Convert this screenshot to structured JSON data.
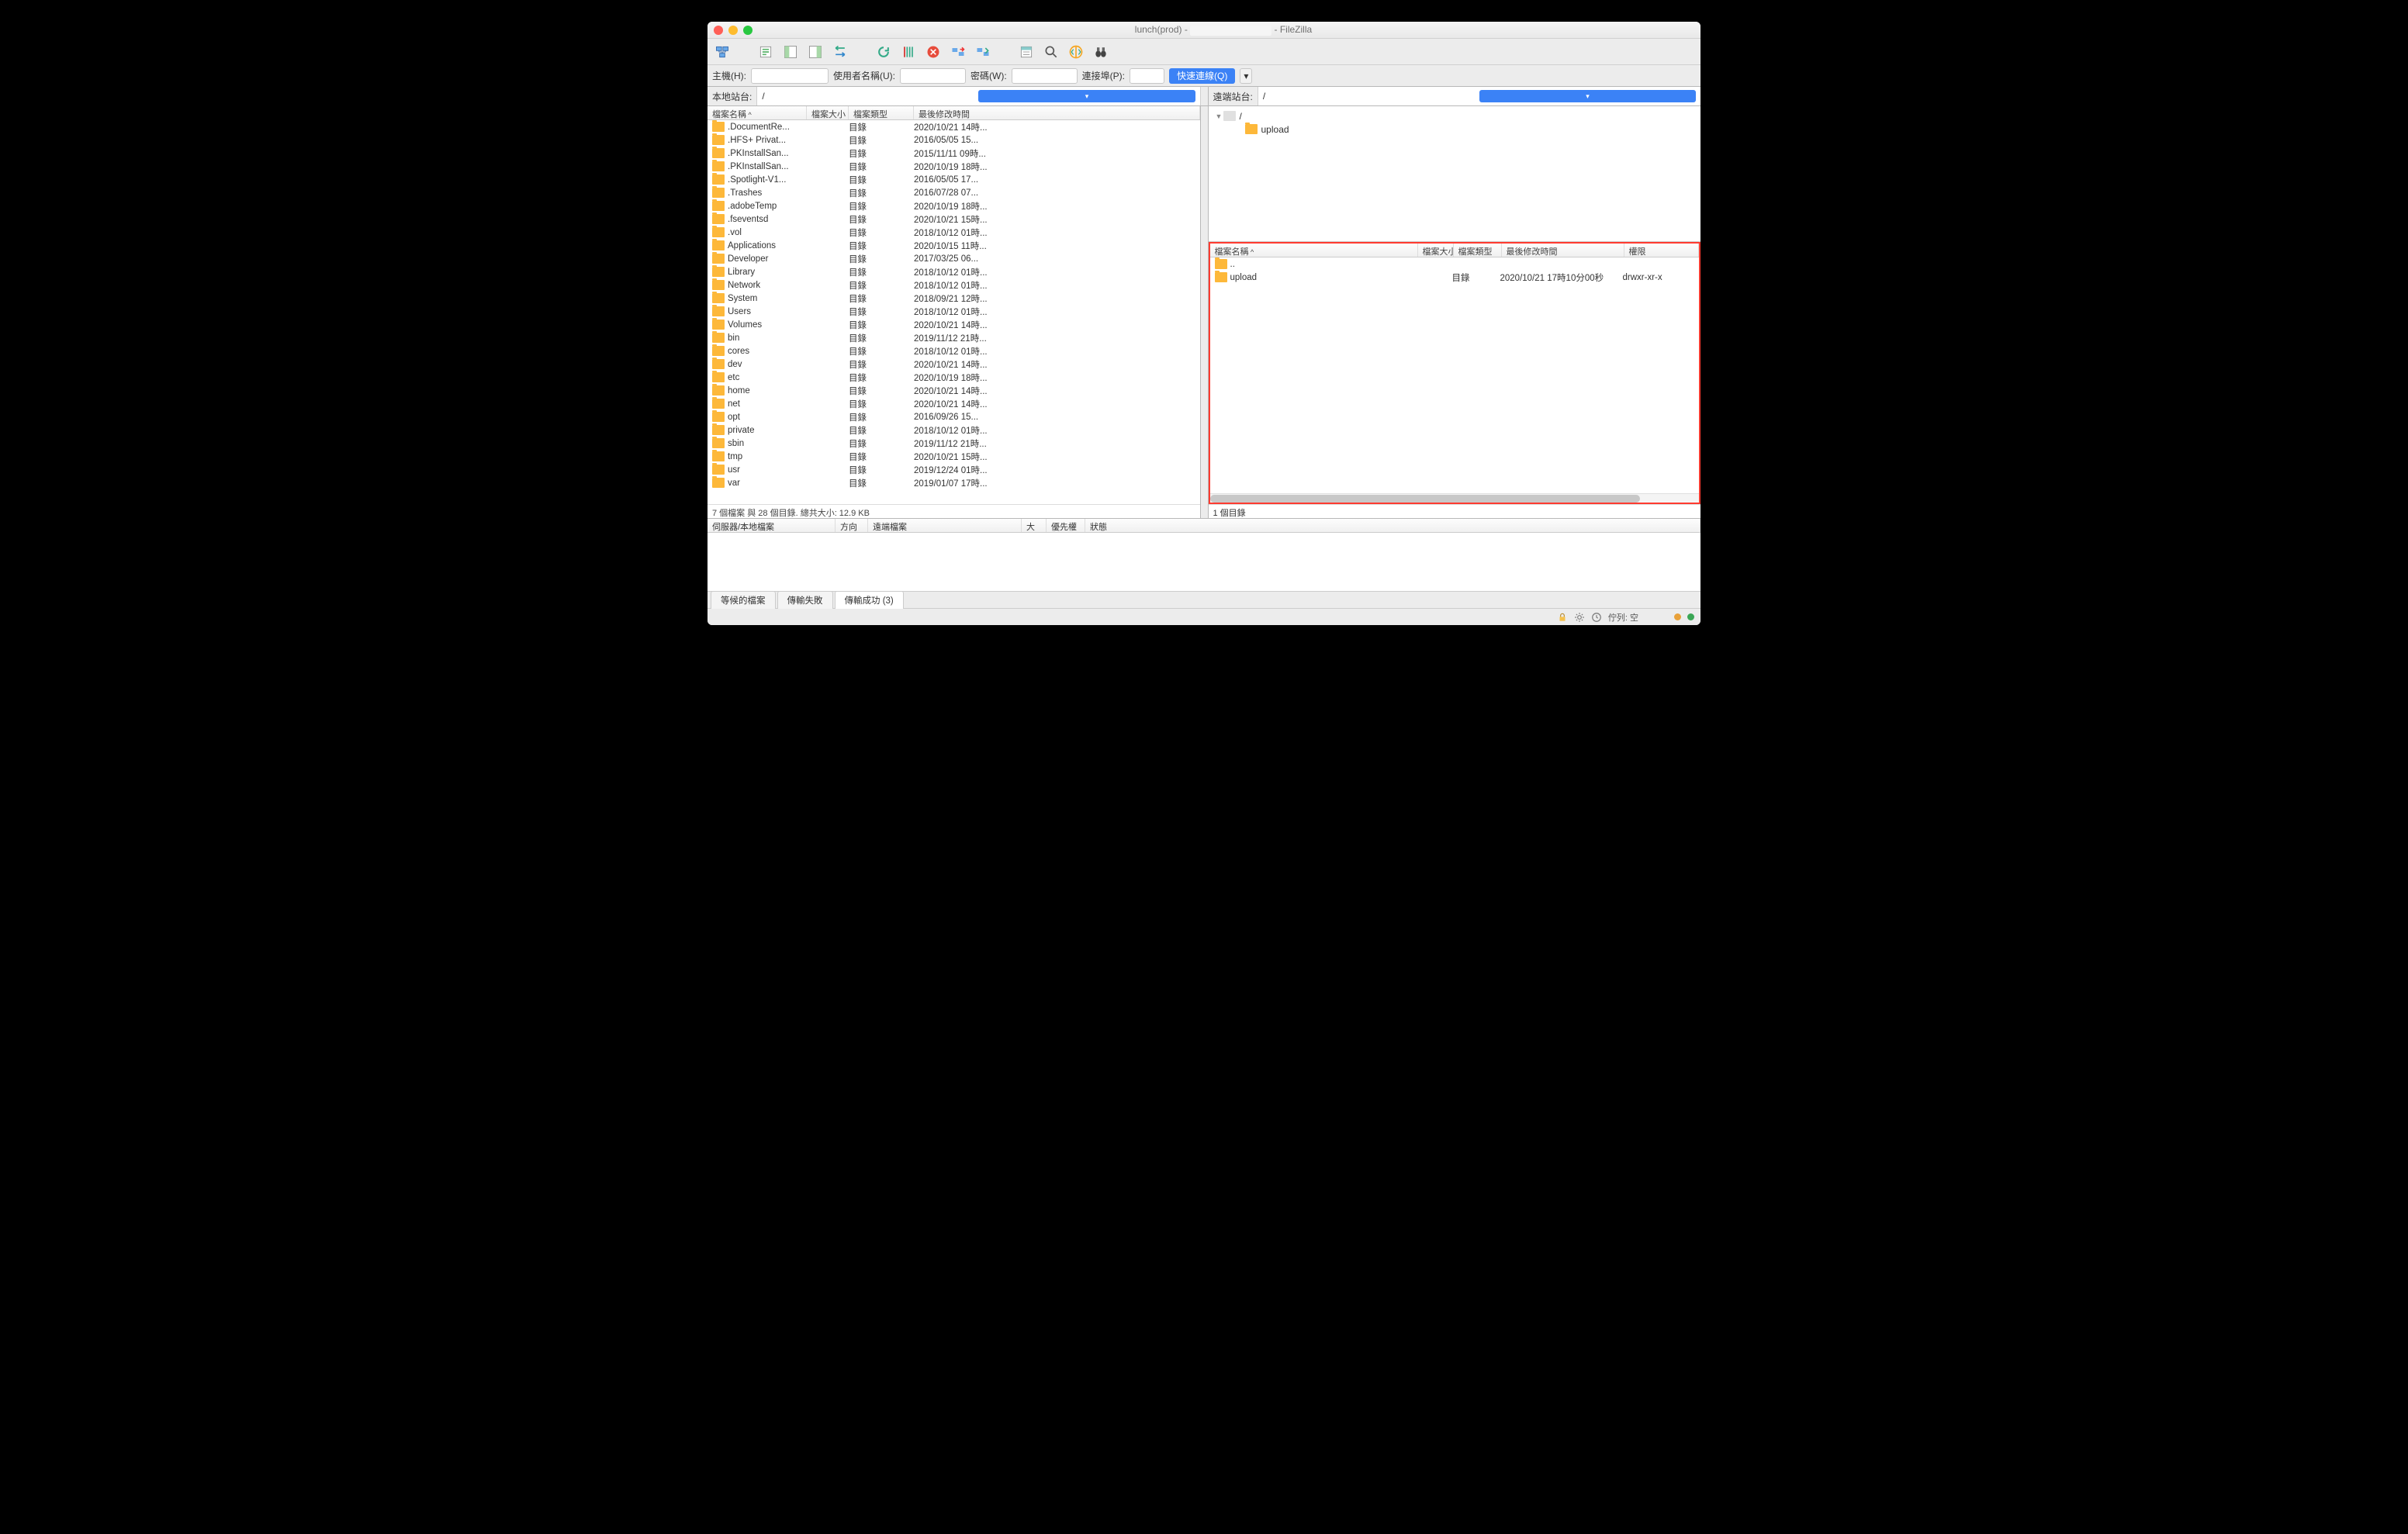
{
  "title": {
    "prefix": "lunch(prod) - ",
    "suffix": " - FileZilla"
  },
  "qc": {
    "host_label": "主機(H):",
    "user_label": "使用者名稱(U):",
    "pass_label": "密碼(W):",
    "port_label": "連接埠(P):",
    "btn": "快速連線(Q)"
  },
  "local": {
    "site_label": "本地站台:",
    "path": "/",
    "cols": {
      "name": "檔案名稱",
      "size": "檔案大小",
      "type": "檔案類型",
      "time": "最後修改時間"
    },
    "type_dir": "目錄",
    "status": "7 個檔案 與 28 個目錄. 總共大小: 12.9 KB",
    "rows": [
      {
        "name": ".DocumentRe...",
        "time": "2020/10/21 14時..."
      },
      {
        "name": ".HFS+ Privat...",
        "time": "2016/05/05 15..."
      },
      {
        "name": ".PKInstallSan...",
        "time": "2015/11/11 09時..."
      },
      {
        "name": ".PKInstallSan...",
        "time": "2020/10/19 18時..."
      },
      {
        "name": ".Spotlight-V1...",
        "time": "2016/05/05 17..."
      },
      {
        "name": ".Trashes",
        "time": "2016/07/28 07..."
      },
      {
        "name": ".adobeTemp",
        "time": "2020/10/19 18時..."
      },
      {
        "name": ".fseventsd",
        "time": "2020/10/21 15時..."
      },
      {
        "name": ".vol",
        "time": "2018/10/12 01時..."
      },
      {
        "name": "Applications",
        "time": "2020/10/15 11時..."
      },
      {
        "name": "Developer",
        "time": "2017/03/25 06..."
      },
      {
        "name": "Library",
        "time": "2018/10/12 01時..."
      },
      {
        "name": "Network",
        "time": "2018/10/12 01時..."
      },
      {
        "name": "System",
        "time": "2018/09/21 12時..."
      },
      {
        "name": "Users",
        "time": "2018/10/12 01時..."
      },
      {
        "name": "Volumes",
        "time": "2020/10/21 14時..."
      },
      {
        "name": "bin",
        "time": "2019/11/12 21時..."
      },
      {
        "name": "cores",
        "time": "2018/10/12 01時..."
      },
      {
        "name": "dev",
        "time": "2020/10/21 14時..."
      },
      {
        "name": "etc",
        "time": "2020/10/19 18時..."
      },
      {
        "name": "home",
        "time": "2020/10/21 14時..."
      },
      {
        "name": "net",
        "time": "2020/10/21 14時..."
      },
      {
        "name": "opt",
        "time": "2016/09/26 15..."
      },
      {
        "name": "private",
        "time": "2018/10/12 01時..."
      },
      {
        "name": "sbin",
        "time": "2019/11/12 21時..."
      },
      {
        "name": "tmp",
        "time": "2020/10/21 15時..."
      },
      {
        "name": "usr",
        "time": "2019/12/24 01時..."
      },
      {
        "name": "var",
        "time": "2019/01/07 17時..."
      }
    ]
  },
  "remote": {
    "site_label": "遠端站台:",
    "path": "/",
    "tree": {
      "root": "/",
      "child": "upload"
    },
    "cols": {
      "name": "檔案名稱",
      "size": "檔案大小",
      "type": "檔案類型",
      "time": "最後修改時間",
      "perm": "權限"
    },
    "rows": [
      {
        "name": "..",
        "type": "",
        "time": "",
        "perm": ""
      },
      {
        "name": "upload",
        "type": "目錄",
        "time": "2020/10/21 17時10分00秒",
        "perm": "drwxr-xr-x"
      }
    ],
    "status": "1 個目錄"
  },
  "queue_cols": {
    "server": "伺服器/本地檔案",
    "dir": "方向",
    "remote": "遠端檔案",
    "size": "大小",
    "prio": "優先權",
    "state": "狀態"
  },
  "btabs": {
    "waiting": "等候的檔案",
    "failed": "傳輸失敗",
    "success": "傳輸成功 (3)"
  },
  "status_queue": "佇列: 空"
}
